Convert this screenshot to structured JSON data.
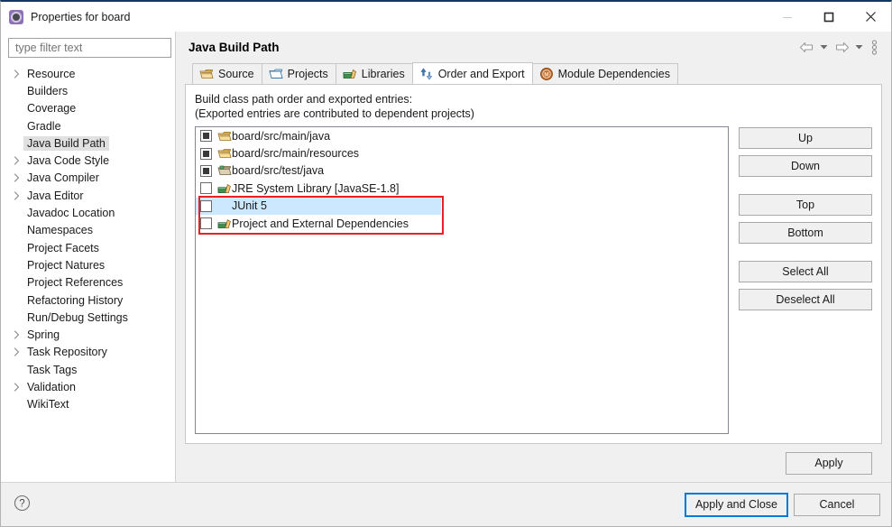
{
  "window": {
    "title": "Properties for board",
    "icon": "properties-gear-icon",
    "controls": [
      {
        "name": "minimize-button",
        "glyph": "minimize"
      },
      {
        "name": "maximize-button",
        "glyph": "maximize"
      },
      {
        "name": "close-button",
        "glyph": "close"
      }
    ]
  },
  "sidebar": {
    "filter": {
      "placeholder": "type filter text",
      "value": ""
    },
    "items": [
      {
        "label": "Resource",
        "expandable": true,
        "selected": false
      },
      {
        "label": "Builders",
        "expandable": false,
        "selected": false
      },
      {
        "label": "Coverage",
        "expandable": false,
        "selected": false
      },
      {
        "label": "Gradle",
        "expandable": false,
        "selected": false
      },
      {
        "label": "Java Build Path",
        "expandable": false,
        "selected": true
      },
      {
        "label": "Java Code Style",
        "expandable": true,
        "selected": false
      },
      {
        "label": "Java Compiler",
        "expandable": true,
        "selected": false
      },
      {
        "label": "Java Editor",
        "expandable": true,
        "selected": false
      },
      {
        "label": "Javadoc Location",
        "expandable": false,
        "selected": false
      },
      {
        "label": "Namespaces",
        "expandable": false,
        "selected": false
      },
      {
        "label": "Project Facets",
        "expandable": false,
        "selected": false
      },
      {
        "label": "Project Natures",
        "expandable": false,
        "selected": false
      },
      {
        "label": "Project References",
        "expandable": false,
        "selected": false
      },
      {
        "label": "Refactoring History",
        "expandable": false,
        "selected": false
      },
      {
        "label": "Run/Debug Settings",
        "expandable": false,
        "selected": false
      },
      {
        "label": "Spring",
        "expandable": true,
        "selected": false
      },
      {
        "label": "Task Repository",
        "expandable": true,
        "selected": false
      },
      {
        "label": "Task Tags",
        "expandable": false,
        "selected": false
      },
      {
        "label": "Validation",
        "expandable": true,
        "selected": false
      },
      {
        "label": "WikiText",
        "expandable": false,
        "selected": false
      }
    ]
  },
  "header": {
    "title": "Java Build Path",
    "toolbar": [
      {
        "name": "back-arrow-icon",
        "glyph": "back"
      },
      {
        "name": "back-dropdown-icon",
        "glyph": "caret"
      },
      {
        "name": "forward-arrow-icon",
        "glyph": "forward"
      },
      {
        "name": "forward-dropdown-icon",
        "glyph": "caret"
      },
      {
        "name": "view-menu-icon",
        "glyph": "vmenu"
      }
    ]
  },
  "tabs": [
    {
      "label": "Source",
      "icon": "source-package-icon",
      "active": false
    },
    {
      "label": "Projects",
      "icon": "projects-folder-icon",
      "active": false
    },
    {
      "label": "Libraries",
      "icon": "libraries-jar-icon",
      "active": false
    },
    {
      "label": "Order and Export",
      "icon": "order-export-arrows-icon",
      "active": true
    },
    {
      "label": "Module Dependencies",
      "icon": "module-dependencies-icon",
      "active": false
    }
  ],
  "panel": {
    "description_line1": "Build class path order and exported entries:",
    "description_line2": "(Exported entries are contributed to dependent projects)",
    "entries": [
      {
        "label": "board/src/main/java",
        "checked": true,
        "icon": "source-folder-icon",
        "highlighted": false
      },
      {
        "label": "board/src/main/resources",
        "checked": true,
        "icon": "source-folder-icon",
        "highlighted": false
      },
      {
        "label": "board/src/test/java",
        "checked": true,
        "icon": "test-folder-icon",
        "highlighted": false
      },
      {
        "label": "JRE System Library [JavaSE-1.8]",
        "checked": false,
        "icon": "library-jar-icon",
        "highlighted": false
      },
      {
        "label": "JUnit 5",
        "checked": false,
        "icon": "library-jar-icon",
        "highlighted": true
      },
      {
        "label": "Project and External Dependencies",
        "checked": false,
        "icon": "library-jar-icon",
        "highlighted": false
      }
    ],
    "annotation": {
      "name": "red-highlight-box",
      "color": "#e8202a"
    },
    "side_buttons": [
      {
        "label": "Up"
      },
      {
        "label": "Down"
      },
      {
        "label": "Top"
      },
      {
        "label": "Bottom"
      },
      {
        "label": "Select All"
      },
      {
        "label": "Deselect All"
      }
    ],
    "apply_label": "Apply"
  },
  "footer": {
    "help_icon": "help-question-icon",
    "apply_and_close_label": "Apply and Close",
    "cancel_label": "Cancel"
  },
  "colors": {
    "accent": "#0078d7",
    "selection": "#cce8ff",
    "annotation": "#e8202a",
    "titlebar_rule": "#17365d"
  }
}
